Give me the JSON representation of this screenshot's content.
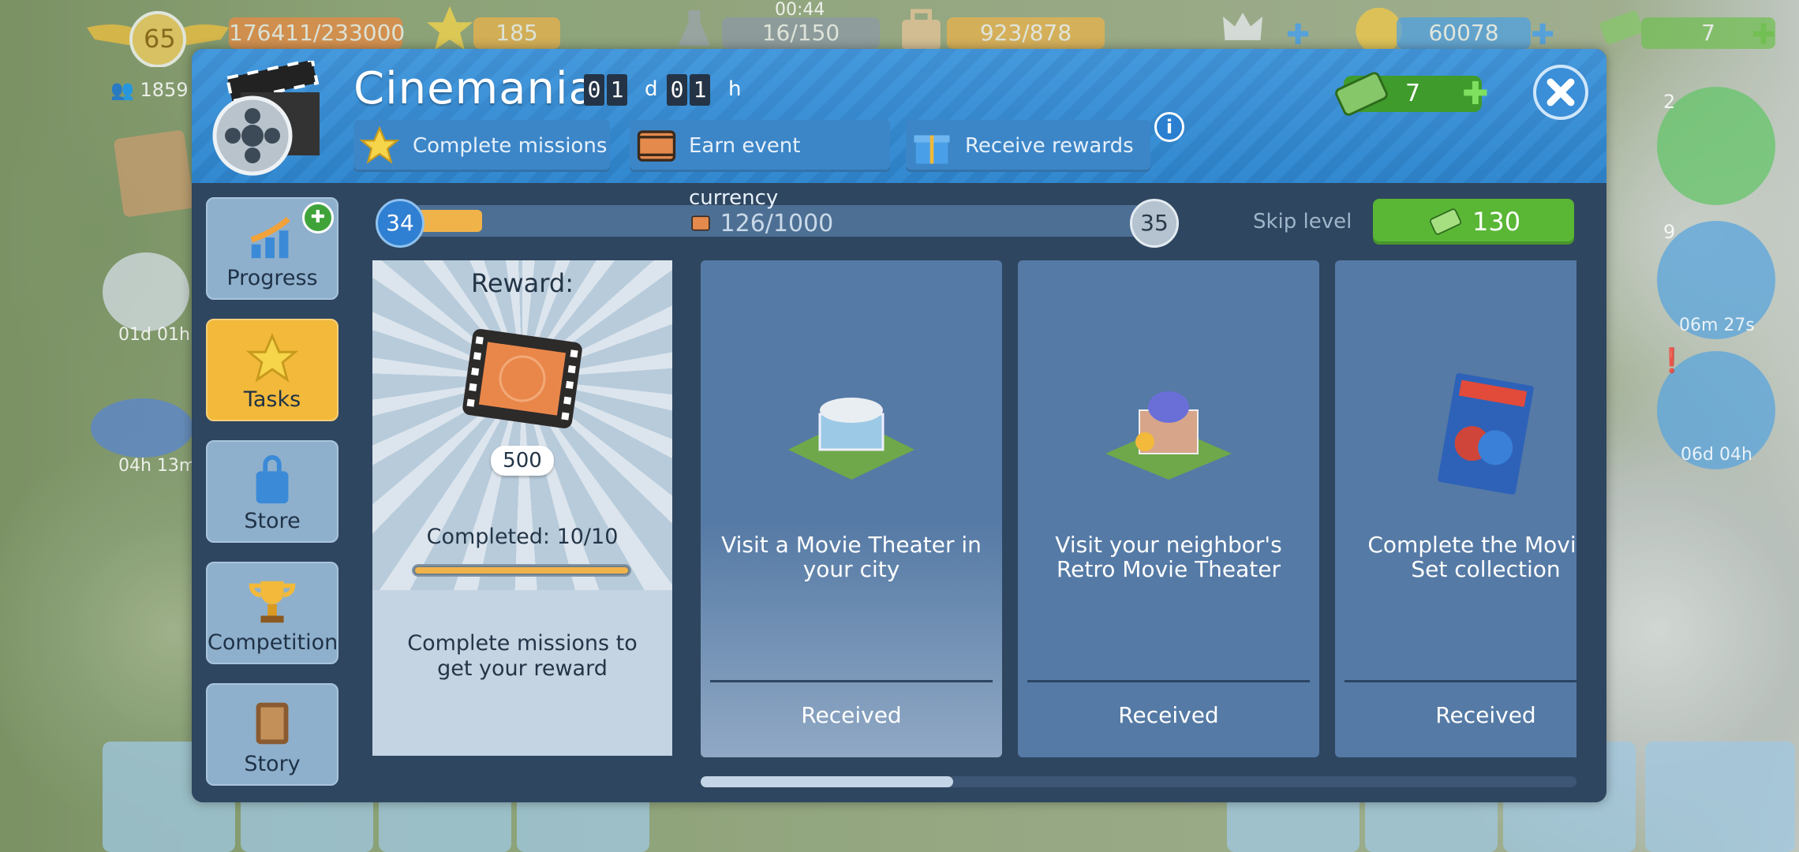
{
  "hud": {
    "level": "65",
    "xp": "176411/233000",
    "stars": "185",
    "clock": "00:44",
    "fuel": "16/150",
    "cargo": "923/878",
    "coins": "60078",
    "cash": "7",
    "population": "1859",
    "tower_badge": "2",
    "radar_badge": "9",
    "radar_timer": "06m 27s",
    "gauge_timer": "06d 04h",
    "left_timer1": "01d 01h",
    "left_timer2": "04h 13m"
  },
  "event": {
    "title": "Cinemania",
    "timer_days": [
      "0",
      "1"
    ],
    "timer_days_unit": "d",
    "timer_hours": [
      "0",
      "1"
    ],
    "timer_hours_unit": "h",
    "steps": [
      "Complete missions",
      "Earn event currency",
      "Receive rewards"
    ],
    "info": "i",
    "cash": "7"
  },
  "nav": [
    {
      "label": "Progress"
    },
    {
      "label": "Tasks"
    },
    {
      "label": "Store"
    },
    {
      "label": "Competition"
    },
    {
      "label": "Story"
    }
  ],
  "progress": {
    "level_current": "34",
    "level_next": "35",
    "text": "126/1000",
    "fraction": 0.126,
    "skip_label": "Skip level",
    "skip_cost": "130"
  },
  "reward": {
    "title": "Reward:",
    "amount": "500",
    "completed": "Completed: 10/10",
    "completed_fraction": 1.0,
    "description": "Complete missions to get your reward"
  },
  "missions": [
    {
      "text": "Visit a Movie Theater in your city",
      "status": "Received"
    },
    {
      "text": "Visit your neighbor's Retro Movie Theater",
      "status": "Received"
    },
    {
      "text": "Complete the Movieg Set collection",
      "status": "Received"
    }
  ],
  "colors": {
    "header": "#3590da",
    "active_tab": "#f2b93a",
    "skip_button": "#59b735",
    "progress_fill": "#f0b349"
  }
}
